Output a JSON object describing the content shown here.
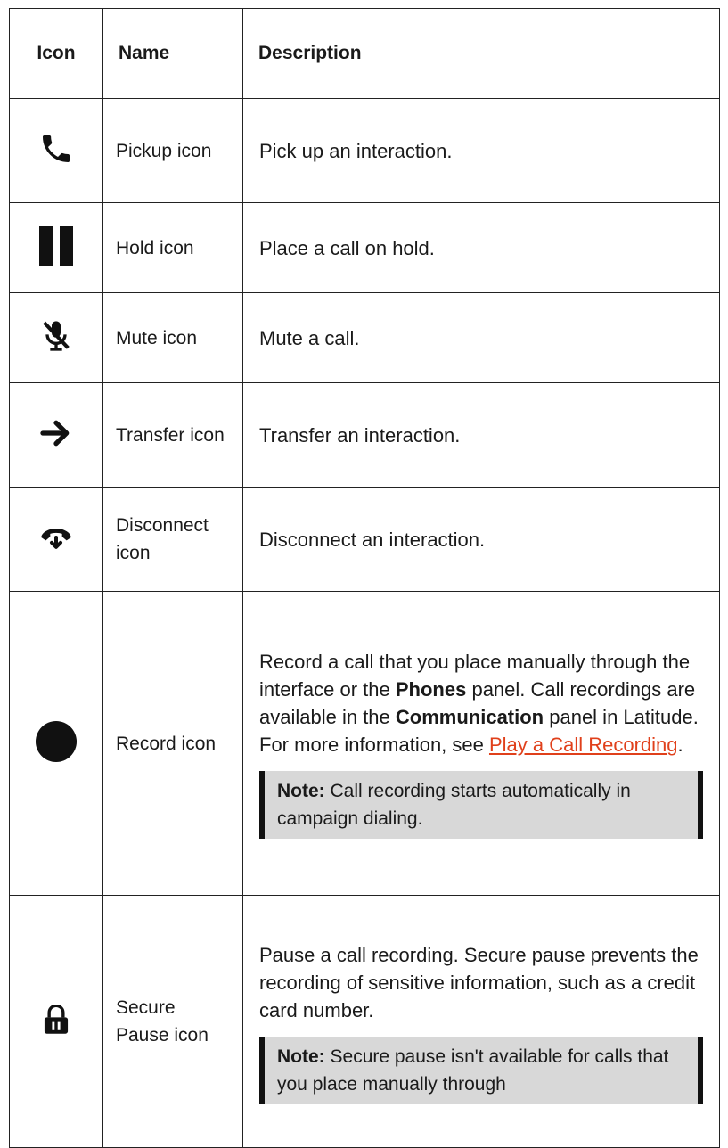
{
  "headers": {
    "icon": "Icon",
    "name": "Name",
    "description": "Description"
  },
  "rows": {
    "pickup": {
      "icon": "phone-icon",
      "name": "Pickup icon",
      "desc": "Pick up an interaction."
    },
    "hold": {
      "icon": "pause-icon",
      "name": "Hold icon",
      "desc": "Place a call on hold."
    },
    "mute": {
      "icon": "microphone-slash-icon",
      "name": "Mute icon",
      "desc": "Mute a call."
    },
    "transfer": {
      "icon": "arrow-right-icon",
      "name": "Transfer icon",
      "desc": "Transfer an interaction."
    },
    "disconnect": {
      "icon": "phone-hangup-icon",
      "name": "Disconnect icon",
      "desc": "Disconnect an interaction."
    },
    "record": {
      "icon": "record-circle-icon",
      "name": "Record icon",
      "desc_1": "Record a call that you place manually through the interface or the ",
      "desc_bold_1": "Phones",
      "desc_2": " panel. Call recordings are available in the ",
      "desc_bold_2": "Communication",
      "desc_3": " panel in Latitude. For more information, see ",
      "desc_link": "Play a Call Recording",
      "desc_4": ".",
      "note_label": "Note:",
      "note_text": " Call recording starts automatically in campaign dialing."
    },
    "secure": {
      "icon": "lock-icon",
      "name": "Secure Pause icon",
      "desc": "Pause a call recording. Secure pause prevents the recording of sensitive information, such as a credit card number.",
      "note_label": "Note:",
      "note_text": " Secure pause isn't available for calls that you place manually through"
    }
  },
  "colors": {
    "link": "#e0401b",
    "note_background": "#d8d8d8",
    "border": "#222222"
  }
}
